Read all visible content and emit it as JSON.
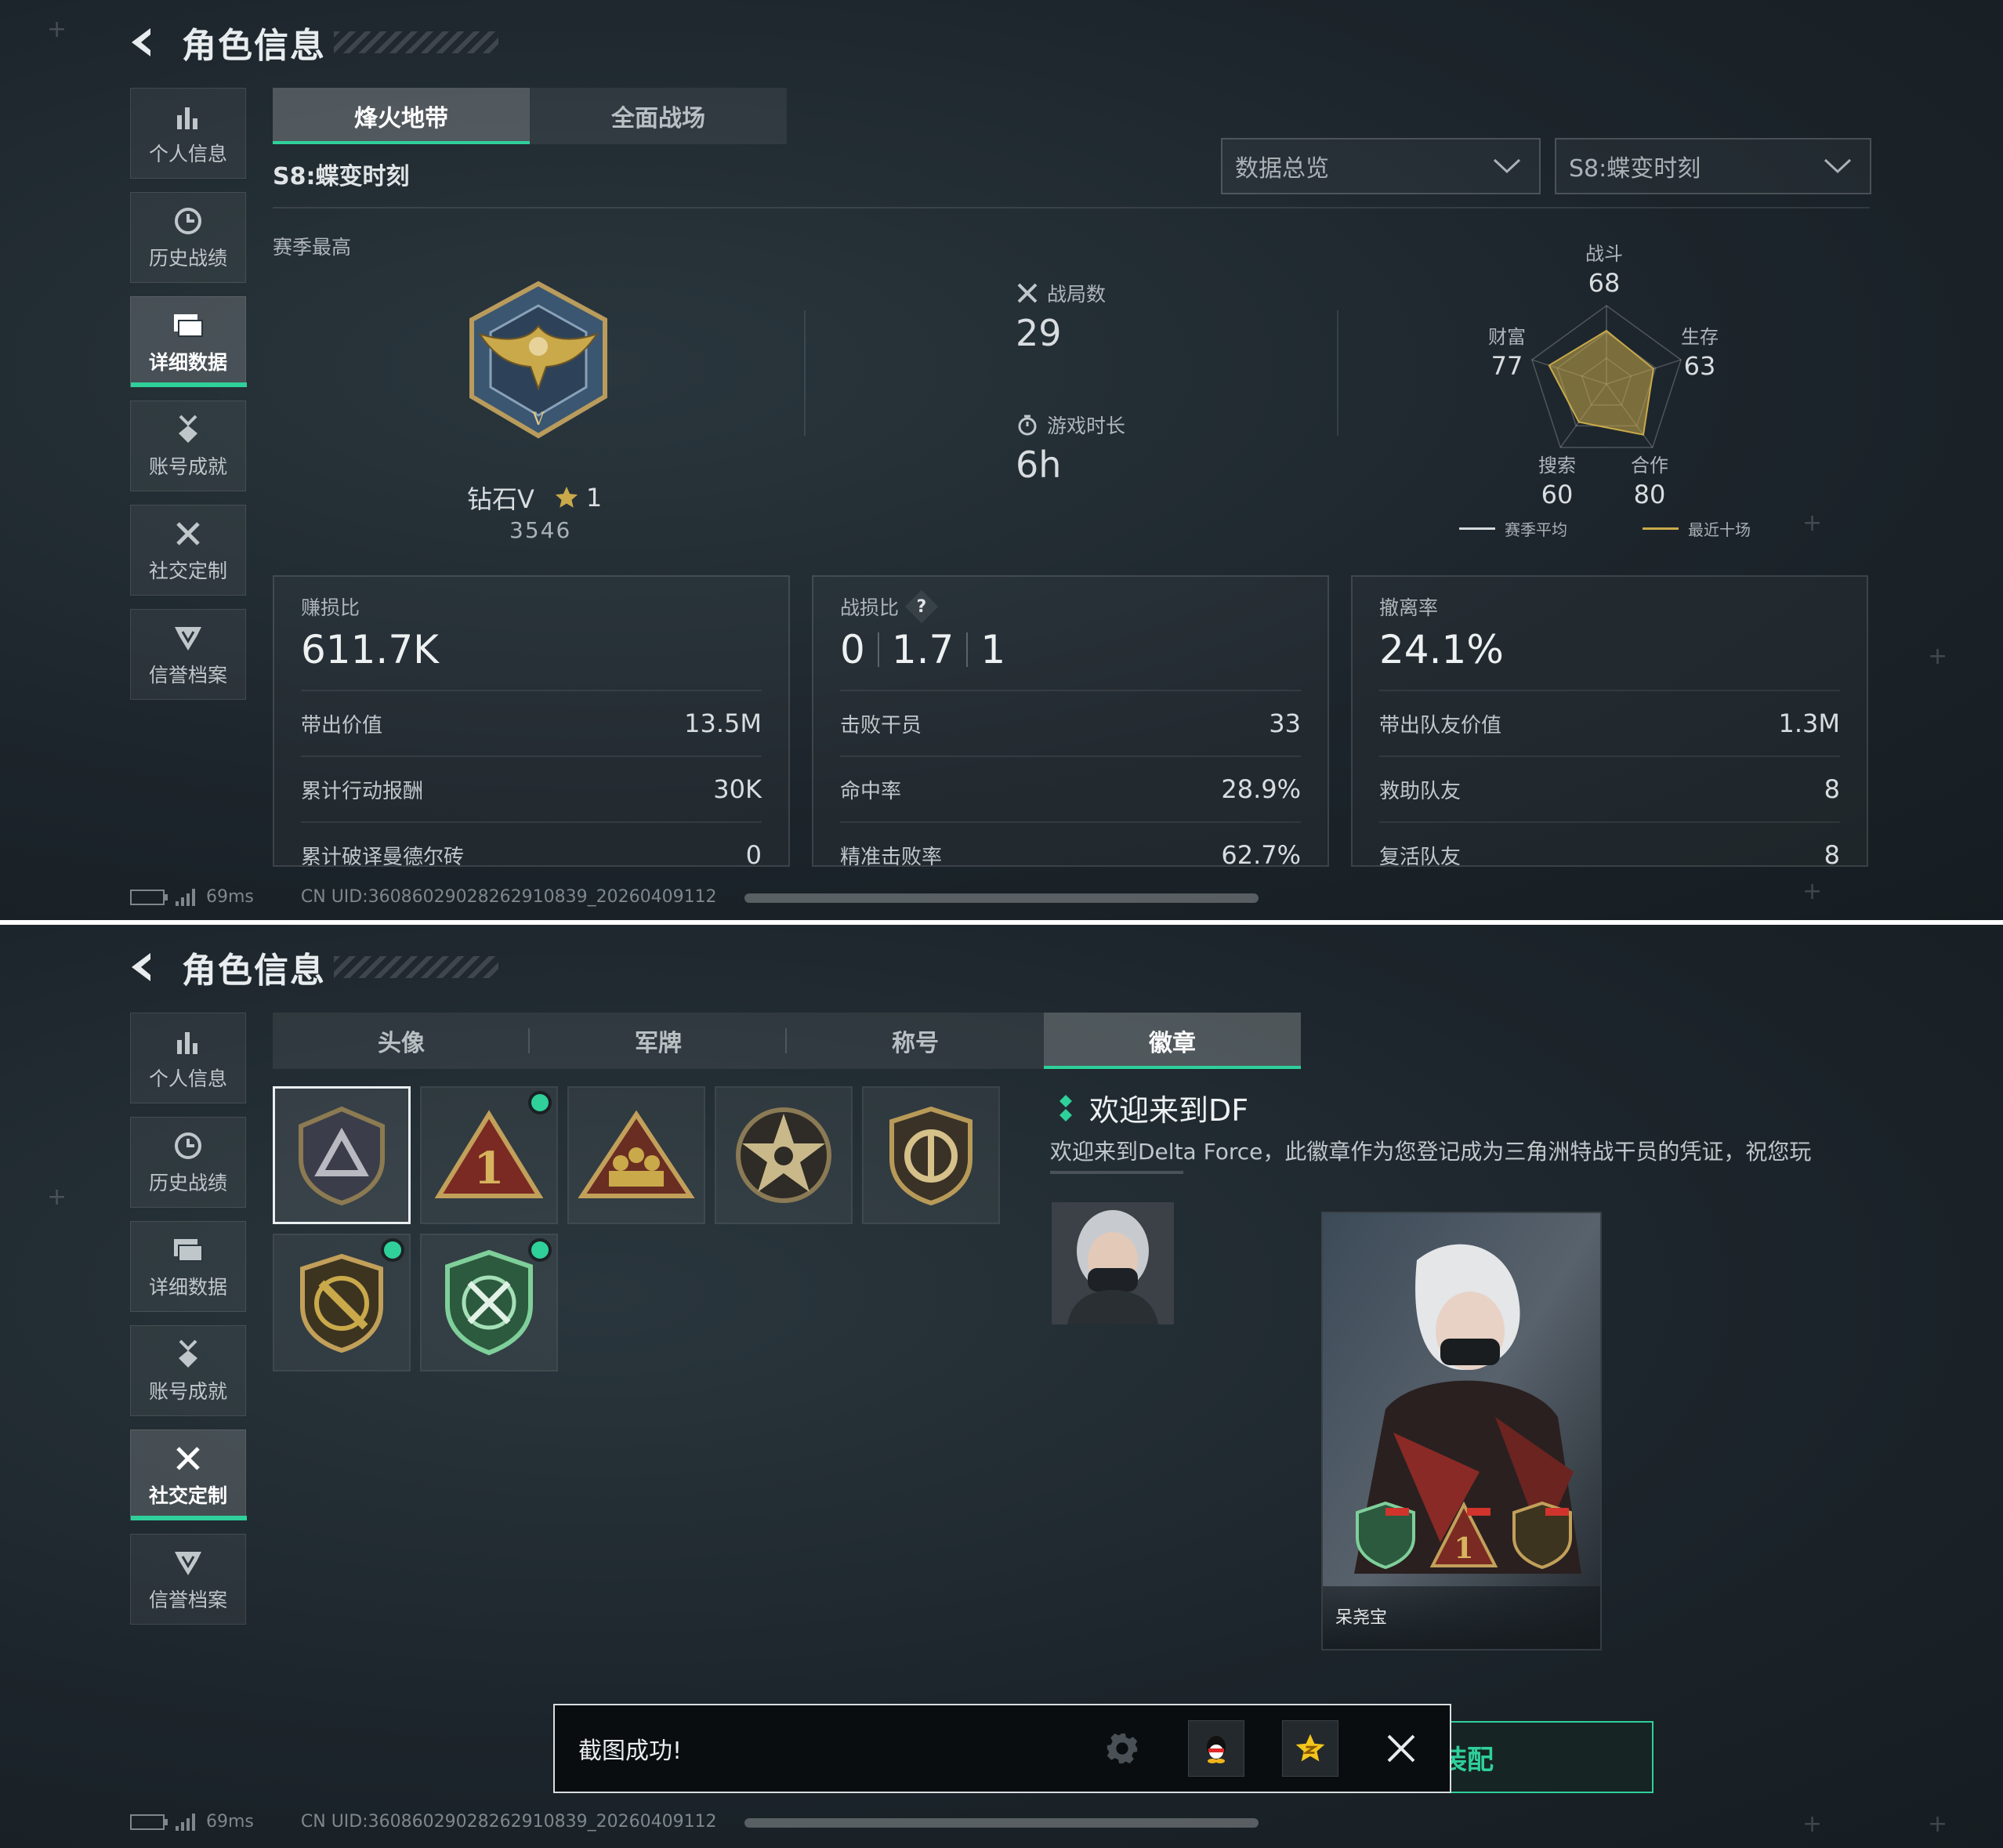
{
  "header": {
    "title": "角色信息"
  },
  "sidebar": {
    "items": [
      {
        "label": "个人信息",
        "icon": "bar-chart-icon"
      },
      {
        "label": "历史战绩",
        "icon": "clock-icon"
      },
      {
        "label": "详细数据",
        "icon": "folder-icon"
      },
      {
        "label": "账号成就",
        "icon": "medal-icon"
      },
      {
        "label": "社交定制",
        "icon": "tools-icon"
      },
      {
        "label": "信誉档案",
        "icon": "shield-wing-icon"
      }
    ]
  },
  "panel1": {
    "active_sidebar": "详细数据",
    "mode_tabs": [
      {
        "label": "烽火地带",
        "active": true
      },
      {
        "label": "全面战场",
        "active": false
      }
    ],
    "season_label": "S8:蝶变时刻",
    "selects": [
      {
        "value": "数据总览"
      },
      {
        "value": "S8:蝶变时刻"
      }
    ],
    "season_best_label": "赛季最高",
    "rank": {
      "name": "钻石V",
      "stars": "1",
      "score": "3546"
    },
    "matches": {
      "label": "战局数",
      "value": "29"
    },
    "playtime": {
      "label": "游戏时长",
      "value": "6h"
    },
    "radar": {
      "axes": [
        {
          "label": "战斗",
          "value": "68"
        },
        {
          "label": "生存",
          "value": "63"
        },
        {
          "label": "合作",
          "value": "80"
        },
        {
          "label": "搜索",
          "value": "60"
        },
        {
          "label": "财富",
          "value": "77"
        }
      ],
      "max": 100,
      "legend": [
        {
          "label": "赛季平均",
          "color": "#d5dadc"
        },
        {
          "label": "最近十场",
          "color": "#c9a94a"
        }
      ]
    },
    "cards": [
      {
        "label": "赚损比",
        "big": "611.7K",
        "rows": [
          {
            "label": "带出价值",
            "value": "13.5M"
          },
          {
            "label": "累计行动报酬",
            "value": "30K"
          },
          {
            "label": "累计破译曼德尔砖",
            "value": "0"
          }
        ]
      },
      {
        "label": "战损比",
        "big_parts": [
          "0",
          "1.7",
          "1"
        ],
        "help": "?",
        "rows": [
          {
            "label": "击败干员",
            "value": "33"
          },
          {
            "label": "命中率",
            "value": "28.9%"
          },
          {
            "label": "精准击败率",
            "value": "62.7%"
          }
        ]
      },
      {
        "label": "撤离率",
        "big": "24.1%",
        "rows": [
          {
            "label": "带出队友价值",
            "value": "1.3M"
          },
          {
            "label": "救助队友",
            "value": "8"
          },
          {
            "label": "复活队友",
            "value": "8"
          }
        ]
      }
    ],
    "footer": {
      "ping": "69ms",
      "uid": "CN UID:360860290282629108​39_20260409112"
    }
  },
  "panel2": {
    "active_sidebar": "社交定制",
    "tabs": [
      {
        "label": "头像",
        "active": false
      },
      {
        "label": "军牌",
        "active": false
      },
      {
        "label": "称号",
        "active": false
      },
      {
        "label": "徽章",
        "active": true
      }
    ],
    "badge_title": "欢迎来到DF",
    "badge_desc": "欢迎来到Delta Force，此徽章作为您登记成为三角洲特战干员的凭证，祝您玩",
    "player_name": "呆尧宝",
    "equip_label": "装配",
    "toast": {
      "message": "截图成功!"
    },
    "footer": {
      "ping": "69ms",
      "uid": "CN UID:360860290282629108​39_20260409112"
    }
  },
  "colors": {
    "accent": "#2fd09a",
    "gold": "#c9a94a",
    "text": "#d5dadc"
  }
}
